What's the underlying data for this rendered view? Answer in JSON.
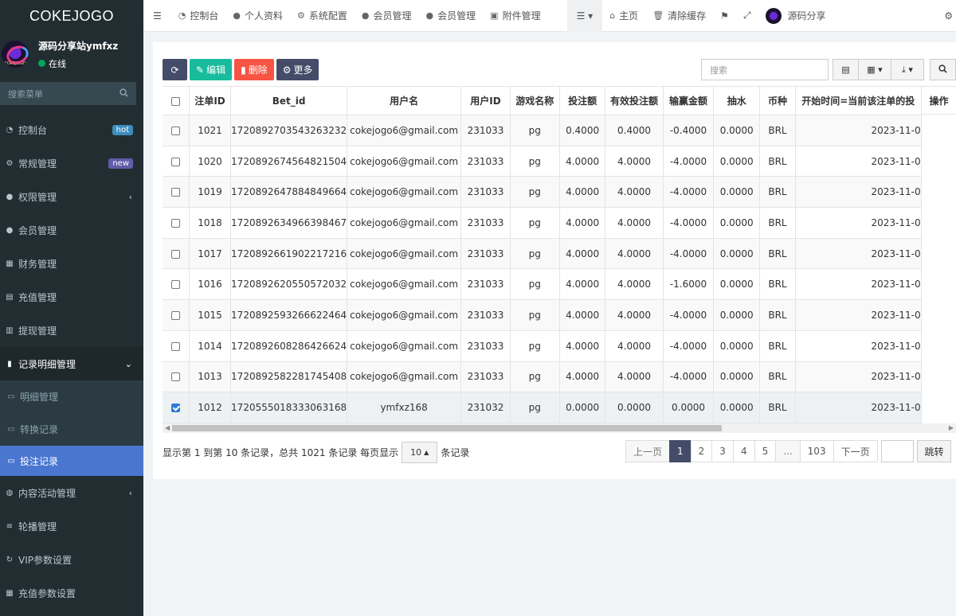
{
  "app": {
    "logo": "COKEJOGO",
    "avatar_text": "COKEJOGO"
  },
  "user": {
    "name": "源码分享站ymfxz",
    "status": "在线"
  },
  "sidebar": {
    "search_placeholder": "搜索菜单",
    "items": [
      {
        "label": "控制台",
        "icon": "dashboard-icon",
        "badge": "hot"
      },
      {
        "label": "常规管理",
        "icon": "cogs-icon",
        "badge": "new"
      },
      {
        "label": "权限管理",
        "icon": "group-icon"
      },
      {
        "label": "会员管理",
        "icon": "user-icon"
      },
      {
        "label": "财务管理",
        "icon": "bank-icon"
      },
      {
        "label": "充值管理",
        "icon": "list-icon"
      },
      {
        "label": "提现管理",
        "icon": "bars-icon"
      },
      {
        "label": "记录明细管理",
        "icon": "chart-icon"
      }
    ],
    "sub_items": [
      {
        "label": "明细管理",
        "icon": "calendar-icon"
      },
      {
        "label": "转换记录",
        "icon": "calendar-icon"
      },
      {
        "label": "投注记录",
        "icon": "calendar-icon"
      }
    ],
    "items_after": [
      {
        "label": "内容活动管理",
        "icon": "circle-icon"
      },
      {
        "label": "轮播管理",
        "icon": "bars-icon"
      },
      {
        "label": "VIP参数设置",
        "icon": "sync-icon"
      },
      {
        "label": "充值参数设置",
        "icon": "grid-icon"
      }
    ]
  },
  "topnav": {
    "items": [
      {
        "label": "控制台",
        "icon": "dashboard-icon"
      },
      {
        "label": "个人资料",
        "icon": "user-icon"
      },
      {
        "label": "系统配置",
        "icon": "gear-icon"
      },
      {
        "label": "会员管理",
        "icon": "group-icon"
      },
      {
        "label": "会员管理",
        "icon": "user-icon"
      },
      {
        "label": "附件管理",
        "icon": "image-icon"
      }
    ],
    "home": "主页",
    "clear_cache": "清除缓存",
    "profile_name": "源码分享"
  },
  "toolbar": {
    "edit": "编辑",
    "delete": "删除",
    "more": "更多",
    "search_placeholder": "搜索"
  },
  "table": {
    "columns": [
      "注单ID",
      "Bet_id",
      "用户名",
      "用户ID",
      "游戏名称",
      "投注额",
      "有效投注额",
      "输赢金额",
      "抽水",
      "币种",
      "开始时间=当前该注单的投",
      "操作"
    ],
    "rows": [
      {
        "id": "1021",
        "bet_id": "1720892703543263232",
        "username": "cokejogo6@gmail.com",
        "uid": "231033",
        "game": "pg",
        "bet": "0.4000",
        "valid": "0.4000",
        "winloss": "-0.4000",
        "fee": "0.0000",
        "currency": "BRL",
        "start": "2023-11-0",
        "checked": false
      },
      {
        "id": "1020",
        "bet_id": "1720892674564821504",
        "username": "cokejogo6@gmail.com",
        "uid": "231033",
        "game": "pg",
        "bet": "4.0000",
        "valid": "4.0000",
        "winloss": "-4.0000",
        "fee": "0.0000",
        "currency": "BRL",
        "start": "2023-11-0",
        "checked": false
      },
      {
        "id": "1019",
        "bet_id": "1720892647884849664",
        "username": "cokejogo6@gmail.com",
        "uid": "231033",
        "game": "pg",
        "bet": "4.0000",
        "valid": "4.0000",
        "winloss": "-4.0000",
        "fee": "0.0000",
        "currency": "BRL",
        "start": "2023-11-0",
        "checked": false
      },
      {
        "id": "1018",
        "bet_id": "1720892634966398467",
        "username": "cokejogo6@gmail.com",
        "uid": "231033",
        "game": "pg",
        "bet": "4.0000",
        "valid": "4.0000",
        "winloss": "-4.0000",
        "fee": "0.0000",
        "currency": "BRL",
        "start": "2023-11-0",
        "checked": false
      },
      {
        "id": "1017",
        "bet_id": "1720892661902217216",
        "username": "cokejogo6@gmail.com",
        "uid": "231033",
        "game": "pg",
        "bet": "4.0000",
        "valid": "4.0000",
        "winloss": "-4.0000",
        "fee": "0.0000",
        "currency": "BRL",
        "start": "2023-11-0",
        "checked": false
      },
      {
        "id": "1016",
        "bet_id": "1720892620550572032",
        "username": "cokejogo6@gmail.com",
        "uid": "231033",
        "game": "pg",
        "bet": "4.0000",
        "valid": "4.0000",
        "winloss": "-1.6000",
        "fee": "0.0000",
        "currency": "BRL",
        "start": "2023-11-0",
        "checked": false
      },
      {
        "id": "1015",
        "bet_id": "1720892593266622464",
        "username": "cokejogo6@gmail.com",
        "uid": "231033",
        "game": "pg",
        "bet": "4.0000",
        "valid": "4.0000",
        "winloss": "-4.0000",
        "fee": "0.0000",
        "currency": "BRL",
        "start": "2023-11-0",
        "checked": false
      },
      {
        "id": "1014",
        "bet_id": "1720892608286426624",
        "username": "cokejogo6@gmail.com",
        "uid": "231033",
        "game": "pg",
        "bet": "4.0000",
        "valid": "4.0000",
        "winloss": "-4.0000",
        "fee": "0.0000",
        "currency": "BRL",
        "start": "2023-11-0",
        "checked": false
      },
      {
        "id": "1013",
        "bet_id": "1720892582281745408",
        "username": "cokejogo6@gmail.com",
        "uid": "231033",
        "game": "pg",
        "bet": "4.0000",
        "valid": "4.0000",
        "winloss": "-4.0000",
        "fee": "0.0000",
        "currency": "BRL",
        "start": "2023-11-0",
        "checked": false
      },
      {
        "id": "1012",
        "bet_id": "1720555018333063168",
        "username": "ymfxz168",
        "uid": "231032",
        "game": "pg",
        "bet": "0.0000",
        "valid": "0.0000",
        "winloss": "0.0000",
        "fee": "0.0000",
        "currency": "BRL",
        "start": "2023-11-0",
        "checked": true
      }
    ]
  },
  "footer": {
    "info_prefix": "显示第 1 到第 10 条记录，总共 1021 条记录 每页显示",
    "page_size": "10",
    "info_suffix": "条记录",
    "pages": [
      "上一页",
      "1",
      "2",
      "3",
      "4",
      "5",
      "...",
      "103",
      "下一页"
    ],
    "active_page": "1",
    "jump": "跳转"
  },
  "colors": {
    "sidebar_bg": "#222d32",
    "active_menu": "#4a76d0",
    "btn_dark": "#444c69",
    "btn_green": "#18bc9c",
    "btn_red": "#f75444"
  }
}
